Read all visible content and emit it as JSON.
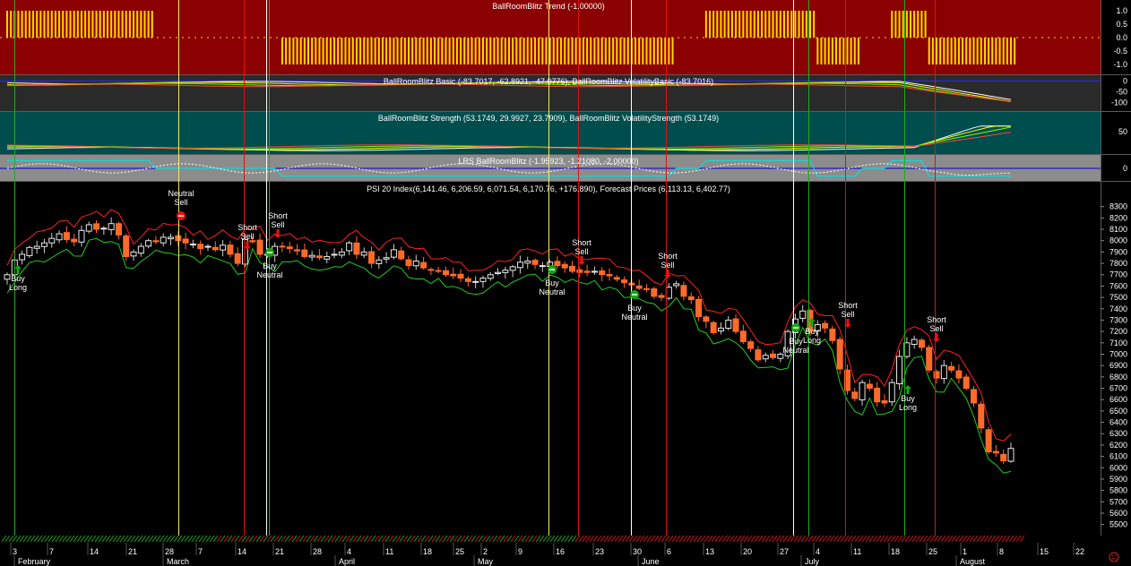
{
  "chart_data": [
    {
      "type": "bar",
      "title": "BallRoomBlitz Trend (-1.00000)",
      "y_ticks": [
        "1.0",
        "0.5",
        "0.0",
        "-0.5",
        "-1.0"
      ],
      "ylim": [
        -1.2,
        1.2
      ],
      "colors": {
        "background": "#8b0000",
        "bars": "#ffd700",
        "zero_line": "#ffd700"
      }
    },
    {
      "type": "line",
      "title": "BallRoomBlitz Basic (-83.7017, -62.8921, -47.0776), BallRoomBlitz VolatilityBasic (-83.7016)",
      "y_ticks": [
        "0",
        "-50",
        "-100"
      ],
      "ylim": [
        -130,
        10
      ],
      "series_colors": [
        "#ffffff",
        "#ffff00",
        "#7fff00",
        "#ff4040"
      ]
    },
    {
      "type": "line",
      "title": "BallRoomBlitz Strength (53.1749, 29.9927, 23.7909), BallRoomBlitz VolatilityStrength (53.1749)",
      "y_ticks": [
        "50"
      ],
      "ylim": [
        0,
        70
      ],
      "series_colors": [
        "#ffffff",
        "#ffff00",
        "#7fff00",
        "#ff4040"
      ]
    },
    {
      "type": "line",
      "title": "LRS BallRoomBlitz (-1.95923, -1.21080, -2.00000)",
      "y_ticks": [
        "0"
      ],
      "ylim": [
        -3,
        3
      ],
      "series_colors": [
        "#00e5e5",
        "#ffffff",
        "#0000cc"
      ]
    },
    {
      "type": "candlestick",
      "title": "PSI 20 Index(6,141.46, 6,206.59, 6,071.54, 6,170.76, +176.890), Forecast Prices (6,113.13, 6,402.77)",
      "ylim": [
        5450,
        8400
      ],
      "y_ticks": [
        "8300",
        "8200",
        "8100",
        "8000",
        "7900",
        "7800",
        "7700",
        "7600",
        "7500",
        "7400",
        "7300",
        "7200",
        "7100",
        "7000",
        "6900",
        "6800",
        "6700",
        "6600",
        "6500",
        "6400",
        "6300",
        "6200",
        "6100",
        "6000",
        "5900",
        "5800",
        "5700",
        "5600",
        "5500"
      ],
      "close": [
        7700,
        7830,
        7880,
        7940,
        7950,
        7980,
        8020,
        8060,
        8010,
        7990,
        8090,
        8140,
        8100,
        8110,
        8150,
        8050,
        7860,
        7900,
        7950,
        8000,
        7990,
        8030,
        8030,
        8000,
        7980,
        7970,
        7930,
        7950,
        7920,
        7960,
        7880,
        7800,
        8010,
        7990,
        7880,
        7880,
        7950,
        7950,
        7930,
        7910,
        7860,
        7870,
        7850,
        7860,
        7880,
        7900,
        7980,
        7880,
        7900,
        7800,
        7830,
        7850,
        7920,
        7840,
        7780,
        7820,
        7760,
        7740,
        7730,
        7700,
        7690,
        7670,
        7640,
        7640,
        7670,
        7700,
        7720,
        7740,
        7770,
        7810,
        7820,
        7790,
        7780,
        7810,
        7780,
        7760,
        7730,
        7720,
        7720,
        7730,
        7700,
        7690,
        7660,
        7630,
        7610,
        7580,
        7570,
        7510,
        7500,
        7590,
        7620,
        7510,
        7480,
        7330,
        7290,
        7190,
        7230,
        7300,
        7200,
        7110,
        7050,
        6950,
        6990,
        6970,
        7000,
        7200,
        7310,
        7380,
        7200,
        7260,
        7230,
        7120,
        6870,
        6680,
        6610,
        6750,
        6700,
        6580,
        6570,
        6750,
        6980,
        7100,
        7130,
        7060,
        6860,
        6790,
        6900,
        6860,
        6790,
        6700,
        6570,
        6350,
        6140,
        6130,
        6060,
        6170
      ],
      "colors": {
        "up": "#e8e8e8",
        "down": "#ff6a2a",
        "upper_band": "#ff2020",
        "lower_band": "#20cc20"
      }
    }
  ],
  "forecast_label": "Forecast Prices",
  "signals": [
    {
      "label_line1": "Buy",
      "label_line2": "Long",
      "kind": "buy"
    },
    {
      "label_line1": "Neutral",
      "label_line2": "Sell",
      "kind": "neutral-sell"
    },
    {
      "label_line1": "Short",
      "label_line2": "Sell",
      "kind": "sell"
    },
    {
      "label_line1": "Short",
      "label_line2": "Sell",
      "kind": "sell"
    },
    {
      "label_line1": "Buy",
      "label_line2": "Neutral",
      "kind": "buy-neutral"
    },
    {
      "label_line1": "Short",
      "label_line2": "Sell",
      "kind": "sell"
    },
    {
      "label_line1": "Buy",
      "label_line2": "Neutral",
      "kind": "buy-neutral"
    },
    {
      "label_line1": "Buy",
      "label_line2": "Neutral",
      "kind": "buy-neutral"
    },
    {
      "label_line1": "Short",
      "label_line2": "Sell",
      "kind": "sell"
    },
    {
      "label_line1": "Buy",
      "label_line2": "Neutral",
      "kind": "buy-neutral"
    },
    {
      "label_line1": "Buy",
      "label_line2": "Long",
      "kind": "buy"
    },
    {
      "label_line1": "Short",
      "label_line2": "Sell",
      "kind": "sell"
    },
    {
      "label_line1": "Buy",
      "label_line2": "Long",
      "kind": "buy"
    },
    {
      "label_line1": "Short",
      "label_line2": "Sell",
      "kind": "sell"
    }
  ],
  "x_axis": {
    "day_ticks": [
      "3",
      "7",
      "14",
      "21",
      "28",
      "7",
      "14",
      "21",
      "28",
      "4",
      "11",
      "18",
      "25",
      "2",
      "9",
      "16",
      "23",
      "30",
      "6",
      "13",
      "20",
      "27",
      "4",
      "11",
      "18",
      "25",
      "1",
      "8",
      "15",
      "22"
    ],
    "month_labels": [
      "February",
      "March",
      "April",
      "May",
      "June",
      "July",
      "August"
    ]
  },
  "vertical_line_colors": {
    "buy": "#22aa22",
    "sell": "#dd1111",
    "neutral": "#eeee66",
    "white": "#ffffff"
  },
  "footer_icon": "sad-face-icon"
}
